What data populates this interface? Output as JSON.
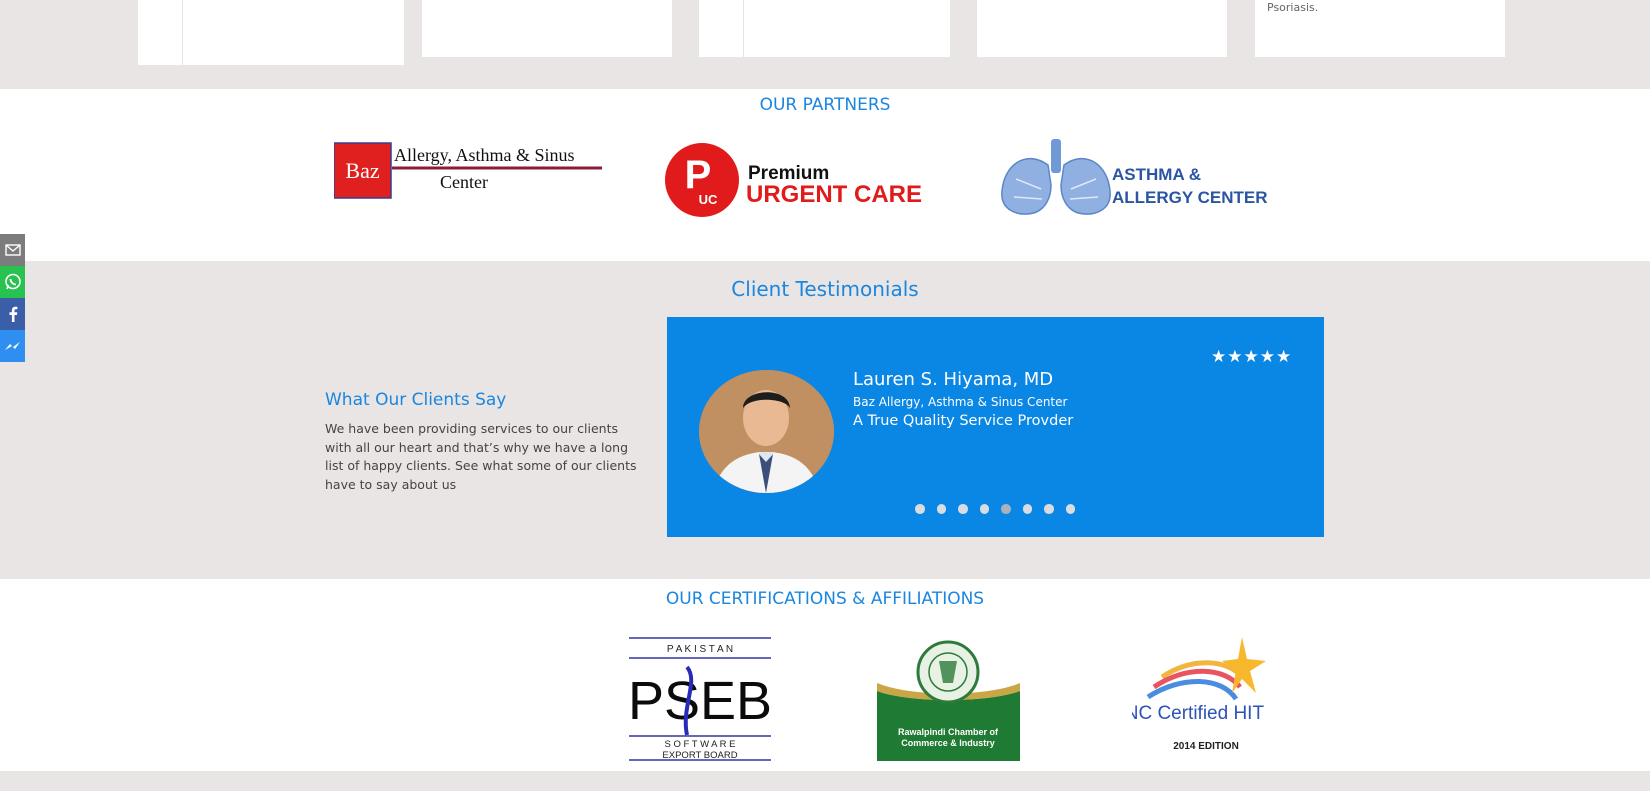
{
  "cards": {
    "card5_text": "Psoriasis."
  },
  "partners": {
    "title": "OUR PARTNERS",
    "items": [
      {
        "line1": "Baz",
        "line2": "Allergy, Asthma & Sinus",
        "line3": "Center"
      },
      {
        "mark": "P",
        "sub": "UC",
        "line1": "Premium",
        "line2": "URGENT CARE"
      },
      {
        "line1": "ASTHMA &",
        "line2": "ALLERGY CENTER"
      }
    ]
  },
  "testimonials": {
    "title": "Client Testimonials",
    "intro_heading": "What Our Clients Say",
    "intro_text": "We have been providing services to our clients with all our heart and that’s why we have a long list of happy clients. See what some of our clients have to say about us",
    "current": {
      "name": "Lauren S. Hiyama, MD",
      "company": "Baz Allergy, Asthma & Sinus Center",
      "quote": "A True Quality Service Provder",
      "stars": 5
    },
    "dots_total": 8,
    "dots_active_index": 4
  },
  "certifications": {
    "title": "OUR CERTIFICATIONS & AFFILIATIONS",
    "items": [
      {
        "top": "P A K I S T A N",
        "main": "PSEB",
        "bottom1": "S O F T W A R E",
        "bottom2": "EXPORT BOARD"
      },
      {
        "line1": "Rawalpindi Chamber of",
        "line2": "Commerce & Industry"
      },
      {
        "line1": "ONC Certified HIT",
        "line2": "2014 EDITION"
      }
    ]
  },
  "social": [
    "mail-icon",
    "whatsapp-icon",
    "facebook-icon",
    "messenger-icon"
  ],
  "colors": {
    "accent": "#1a86e0",
    "card_blue": "#0a86e4",
    "baz_red": "#e0201f",
    "puc_red": "#e11b1b",
    "aac_blue": "#2a55a3",
    "rcci_green": "#1f7a33"
  }
}
